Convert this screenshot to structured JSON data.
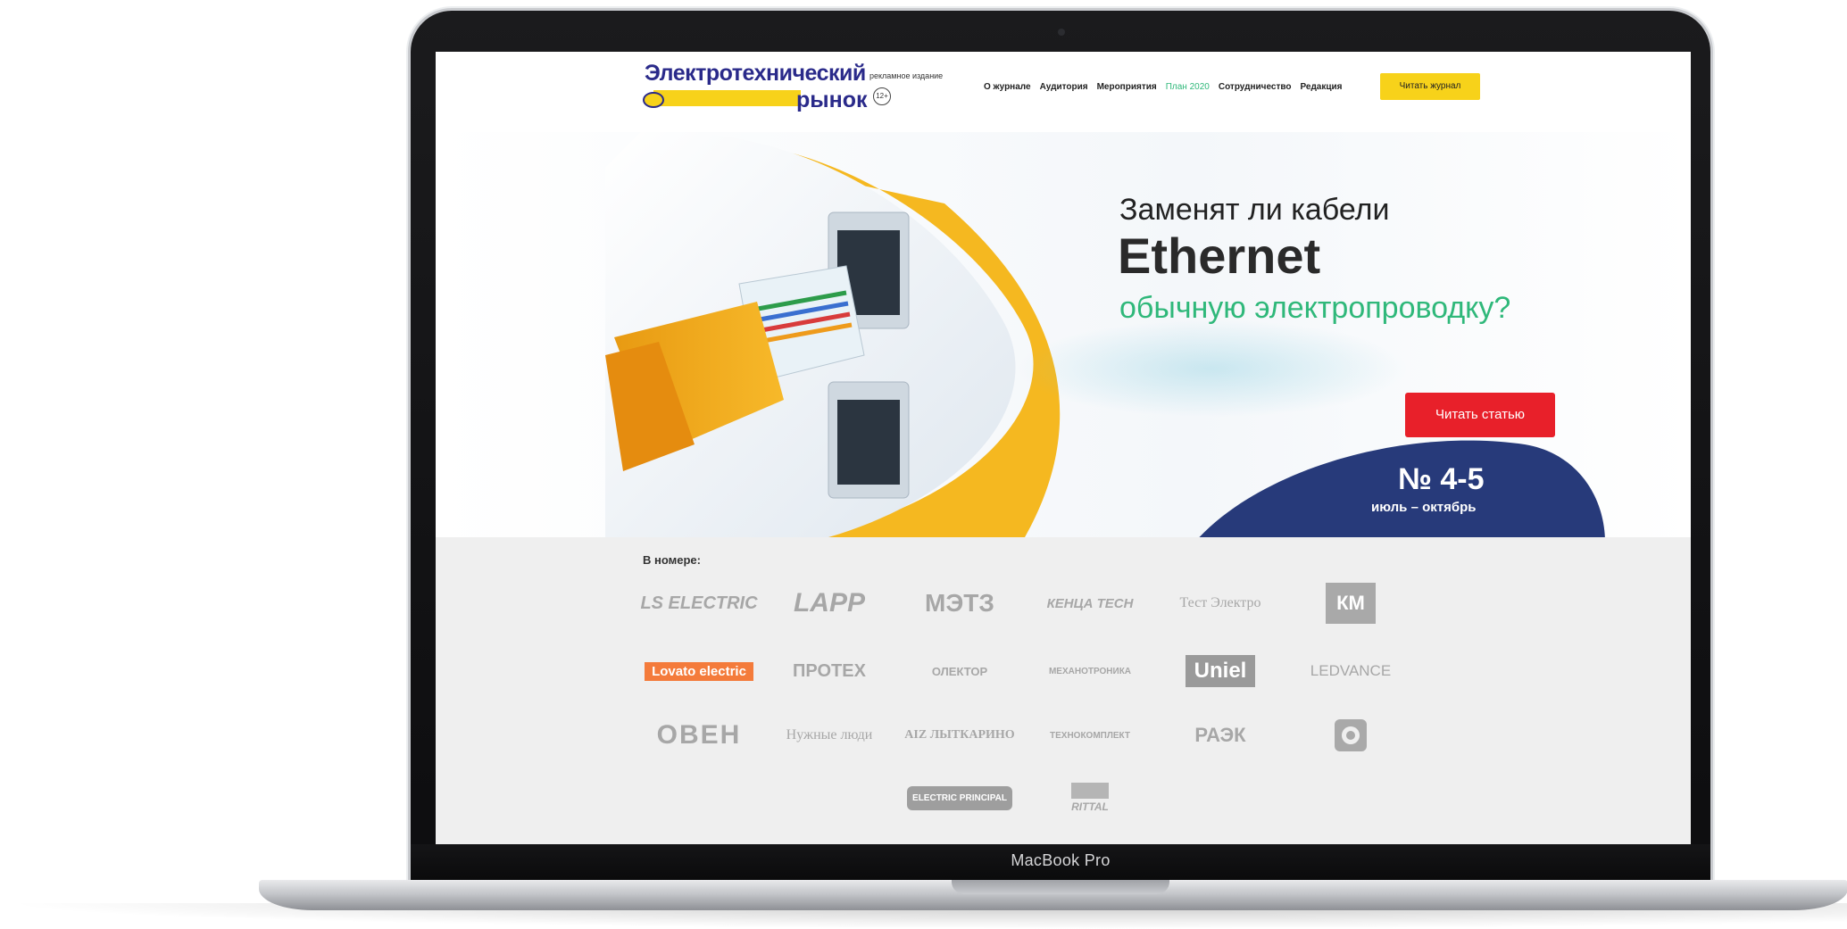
{
  "device": {
    "label": "MacBook Pro"
  },
  "header": {
    "logo_line1": "Электротехнический",
    "logo_line2": "рынок",
    "logo_subtitle": "рекламное издание",
    "age_rating": "12+",
    "nav": [
      "О журнале",
      "Аудитория",
      "Мероприятия",
      "План 2020",
      "Сотрудничество",
      "Редакция"
    ],
    "read_journal_button": "Читать журнал"
  },
  "hero": {
    "title_line1": "Заменят ли кабели",
    "title_line2": "Ethernet",
    "title_line3": "обычную электропроводку?",
    "read_article_button": "Читать статью",
    "issue_number": "№ 4-5",
    "issue_dates": "июль – октябрь"
  },
  "partners": {
    "title": "В номере:",
    "logos": [
      "LS ELECTRIC",
      "LAPP",
      "МЭТЗ",
      "КЕНЦА TECH",
      "Тест Электро",
      "КМ",
      "Lovato electric",
      "ПРОТЕХ",
      "ОЛЕКТОР",
      "МЕХАНОТРОНИКА",
      "Uniel",
      "LEDVANCE",
      "ОВЕН",
      "Нужные люди",
      "AIZ ЛЫТКАРИНО",
      "ТЕХНОКОМПЛЕКТ",
      "РАЭК",
      "",
      "ELECTRIC PRINCIPAL",
      "RITTAL"
    ]
  },
  "colors": {
    "brand_blue": "#2a2a8a",
    "brand_yellow": "#f7d21a",
    "accent_green": "#2fb87a",
    "cta_red": "#e8202a",
    "issue_navy": "#273a7a"
  }
}
